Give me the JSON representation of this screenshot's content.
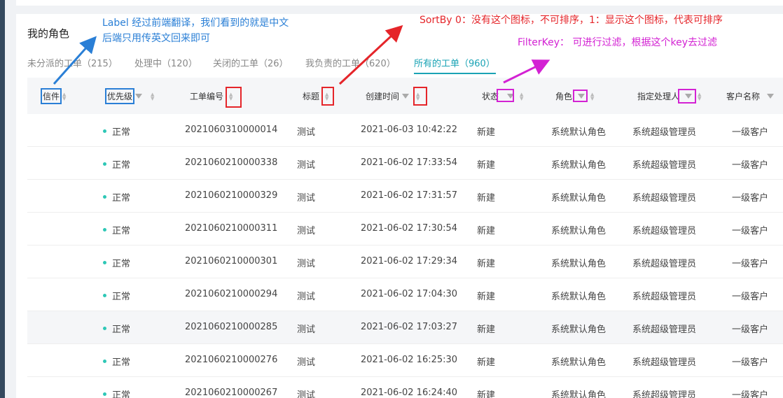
{
  "page": {
    "title": "我的角色"
  },
  "tabs": [
    {
      "label": "未分派的工单（215）"
    },
    {
      "label": "处理中（120）"
    },
    {
      "label": "关闭的工单（26）"
    },
    {
      "label": "我负责的工单（620）"
    },
    {
      "label": "所有的工单（960）"
    }
  ],
  "active_tab": "所有的工单（960）",
  "columns": [
    {
      "label": "信件",
      "sortable": true,
      "filterable": false
    },
    {
      "label": "优先级",
      "sortable": true,
      "filterable": true
    },
    {
      "label": "工单编号",
      "sortable": true,
      "filterable": false
    },
    {
      "label": "标题",
      "sortable": true,
      "filterable": false
    },
    {
      "label": "创建时间",
      "sortable": true,
      "filterable": true
    },
    {
      "label": "状态",
      "sortable": true,
      "filterable": true
    },
    {
      "label": "角色",
      "sortable": true,
      "filterable": true
    },
    {
      "label": "指定处理人",
      "sortable": true,
      "filterable": true
    },
    {
      "label": "客户名称",
      "sortable": false,
      "filterable": true
    }
  ],
  "rows": [
    {
      "priority": "正常",
      "ticket_no": "2021060310000014",
      "title": "测试",
      "created": "2021-06-03 10:42:22",
      "status": "新建",
      "role": "系统默认角色",
      "assignee": "系统超级管理员",
      "customer": "一级客户"
    },
    {
      "priority": "正常",
      "ticket_no": "2021060210000338",
      "title": "测试",
      "created": "2021-06-02 17:33:54",
      "status": "新建",
      "role": "系统默认角色",
      "assignee": "系统超级管理员",
      "customer": "一级客户"
    },
    {
      "priority": "正常",
      "ticket_no": "2021060210000329",
      "title": "测试",
      "created": "2021-06-02 17:31:57",
      "status": "新建",
      "role": "系统默认角色",
      "assignee": "系统超级管理员",
      "customer": "一级客户"
    },
    {
      "priority": "正常",
      "ticket_no": "2021060210000311",
      "title": "测试",
      "created": "2021-06-02 17:30:54",
      "status": "新建",
      "role": "系统默认角色",
      "assignee": "系统超级管理员",
      "customer": "一级客户"
    },
    {
      "priority": "正常",
      "ticket_no": "2021060210000301",
      "title": "测试",
      "created": "2021-06-02 17:29:34",
      "status": "新建",
      "role": "系统默认角色",
      "assignee": "系统超级管理员",
      "customer": "一级客户"
    },
    {
      "priority": "正常",
      "ticket_no": "2021060210000294",
      "title": "测试",
      "created": "2021-06-02 17:04:30",
      "status": "新建",
      "role": "系统默认角色",
      "assignee": "系统超级管理员",
      "customer": "一级客户"
    },
    {
      "priority": "正常",
      "ticket_no": "2021060210000285",
      "title": "测试",
      "created": "2021-06-02 17:03:27",
      "status": "新建",
      "role": "系统默认角色",
      "assignee": "系统超级管理员",
      "customer": "一级客户"
    },
    {
      "priority": "正常",
      "ticket_no": "2021060210000276",
      "title": "测试",
      "created": "2021-06-02 16:25:30",
      "status": "新建",
      "role": "系统默认角色",
      "assignee": "系统超级管理员",
      "customer": "一级客户"
    },
    {
      "priority": "正常",
      "ticket_no": "2021060210000267",
      "title": "测试",
      "created": "2021-06-02 16:24:40",
      "status": "新建",
      "role": "系统默认角色",
      "assignee": "系统超级管理员",
      "customer": "一级客户"
    }
  ],
  "annotations": {
    "label_note_line1": "Label 经过前端翻译，我们看到的就是中文",
    "label_note_line2": "后端只用传英文回来即可",
    "sortby_note": "SortBy 0：没有这个图标，不可排序，1：显示这个图标，代表可排序",
    "filterkey_note": "FilterKey： 可进行过滤，根据这个key去过滤"
  },
  "colors": {
    "accent": "#1aa3b5",
    "status_dot": "#2ec7b6",
    "annotation_blue": "#2a7fd6",
    "annotation_red": "#e5252a",
    "annotation_magenta": "#d322d3"
  }
}
